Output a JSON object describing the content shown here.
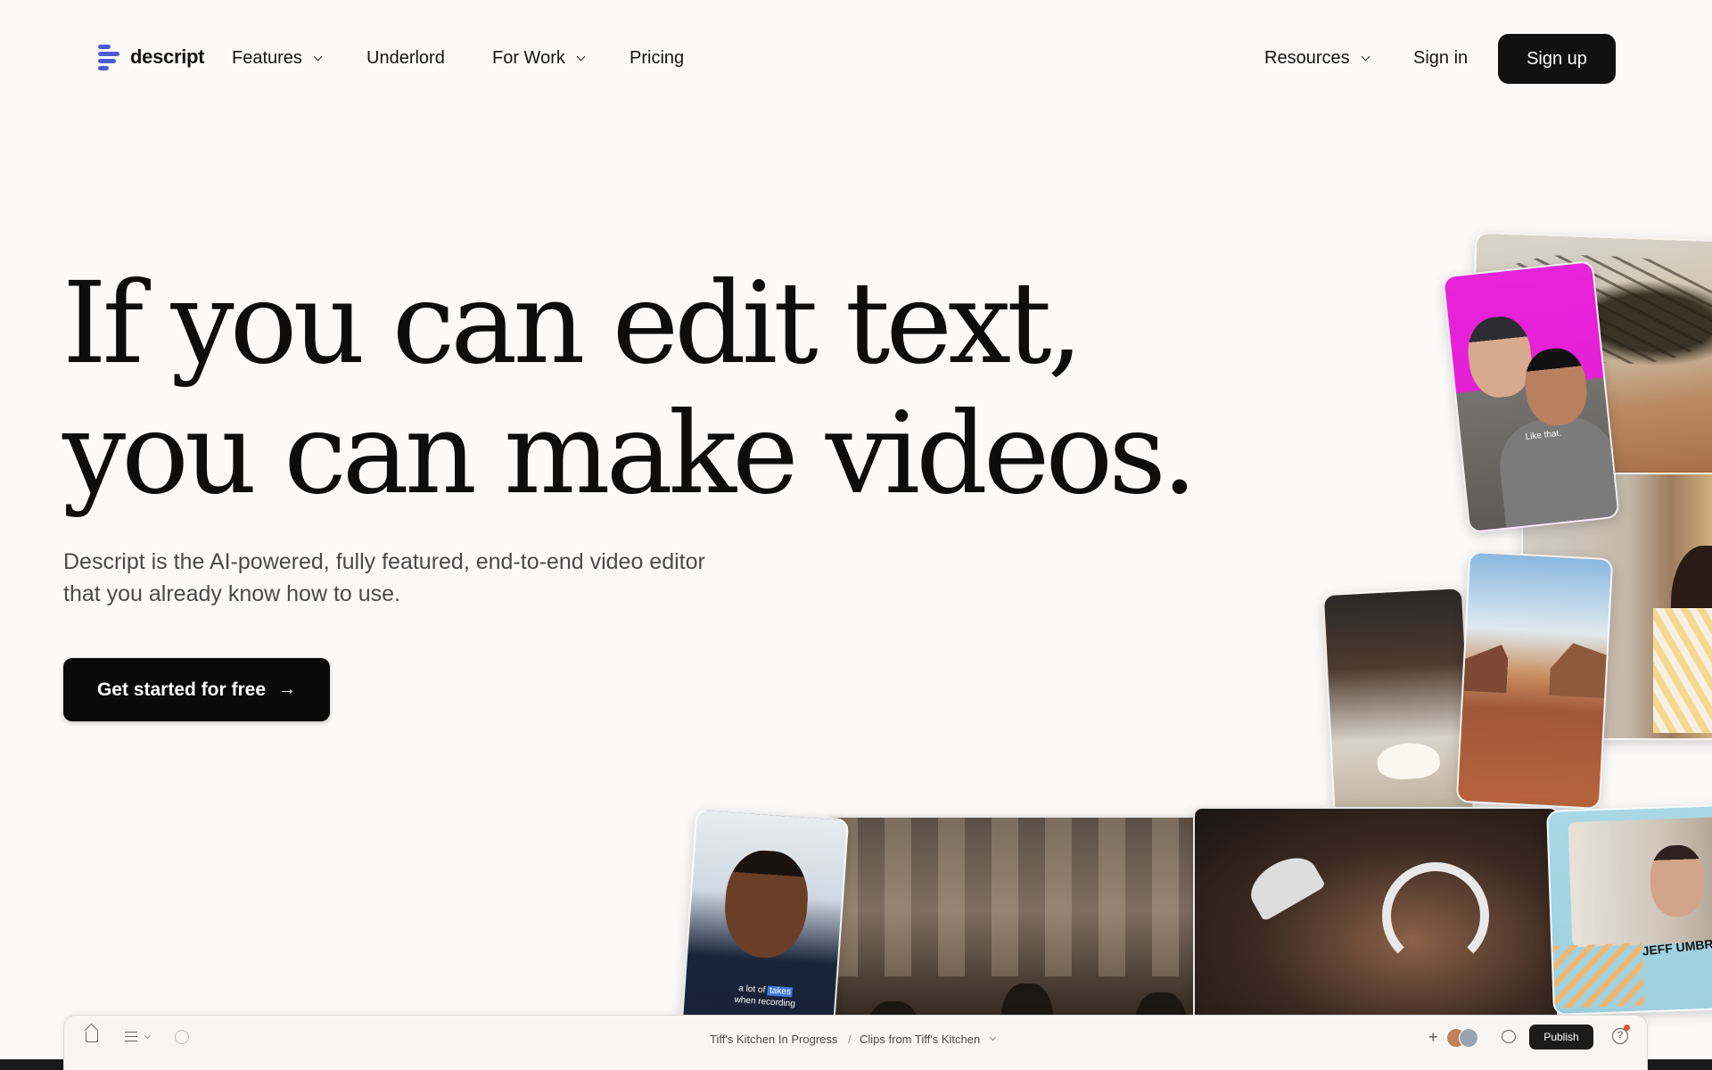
{
  "brand": {
    "name": "descript",
    "accent": "#4c5bd4"
  },
  "nav": {
    "items": [
      {
        "label": "Features",
        "has_dropdown": true
      },
      {
        "label": "Underlord",
        "has_dropdown": false
      },
      {
        "label": "For Work",
        "has_dropdown": true
      },
      {
        "label": "Pricing",
        "has_dropdown": false
      }
    ],
    "resources": "Resources",
    "sign_in": "Sign in",
    "sign_up": "Sign up"
  },
  "hero": {
    "headline_line1": "If you can edit text,",
    "headline_line2": "you can make videos.",
    "subheading_line1": "Descript is the AI-powered, fully featured, end-to-end video editor",
    "subheading_line2": "that you already know how to use.",
    "cta": "Get started for free",
    "cta_icon": "arrow-right-icon"
  },
  "collage": {
    "pink_card_caption": "Like that.",
    "captioned_card": {
      "caption_before": "a lot of ",
      "caption_highlight": "takes",
      "caption_after": "when recording"
    },
    "name_lower_third": "JEFF UMBRO"
  },
  "editor": {
    "breadcrumb_project": "Tiff's Kitchen In Progress",
    "breadcrumb_separator": "/",
    "breadcrumb_composition": "Clips from Tiff's Kitchen",
    "publish": "Publish",
    "help": "?"
  }
}
